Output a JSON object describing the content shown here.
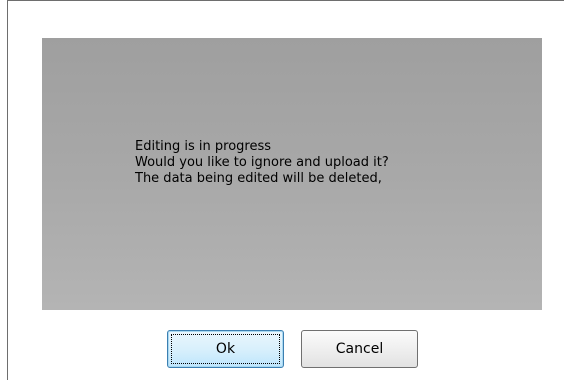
{
  "dialog": {
    "message_lines": [
      "Editing is in progress",
      "Would you like to ignore and upload it?",
      "The data being edited will be deleted,"
    ],
    "buttons": {
      "ok_label": "Ok",
      "cancel_label": "Cancel"
    }
  }
}
